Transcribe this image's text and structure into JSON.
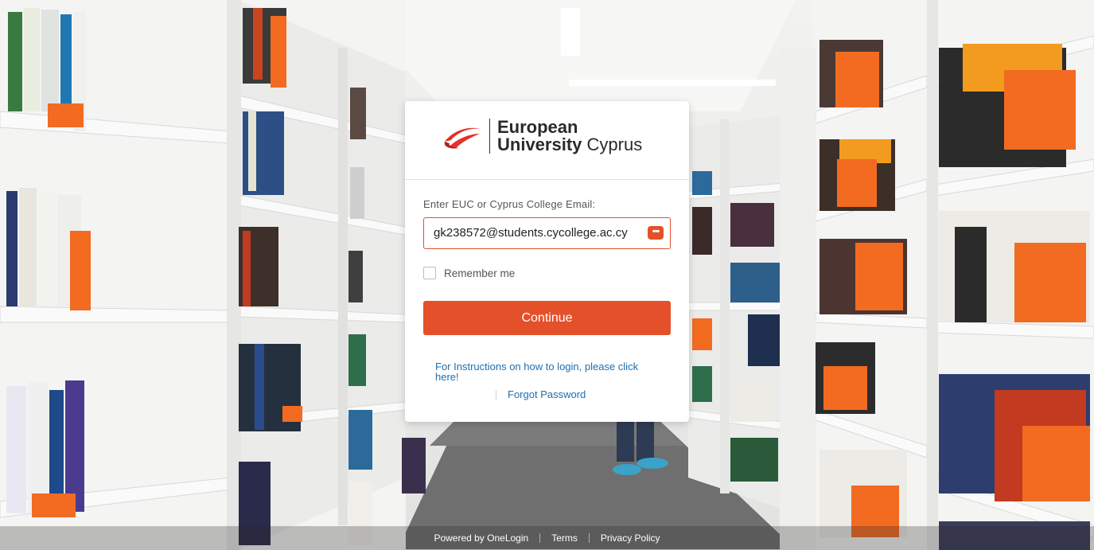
{
  "brand": {
    "name_line1": "European",
    "name_line2_bold": "University",
    "name_line2_regular": "Cyprus",
    "accent_color": "#e4502a",
    "link_color": "#1d6fb0"
  },
  "login": {
    "email_label": "Enter EUC or Cyprus College Email:",
    "email_value": "gk238572@students.cycollege.ac.cy",
    "password_manager_icon": "password-manager-icon",
    "remember_label": "Remember me",
    "remember_checked": false,
    "continue_label": "Continue",
    "instructions_link": "For Instructions on how to login, please click here!",
    "forgot_password": "Forgot Password"
  },
  "footer": {
    "powered_by": "Powered by OneLogin",
    "terms": "Terms",
    "privacy": "Privacy Policy"
  }
}
